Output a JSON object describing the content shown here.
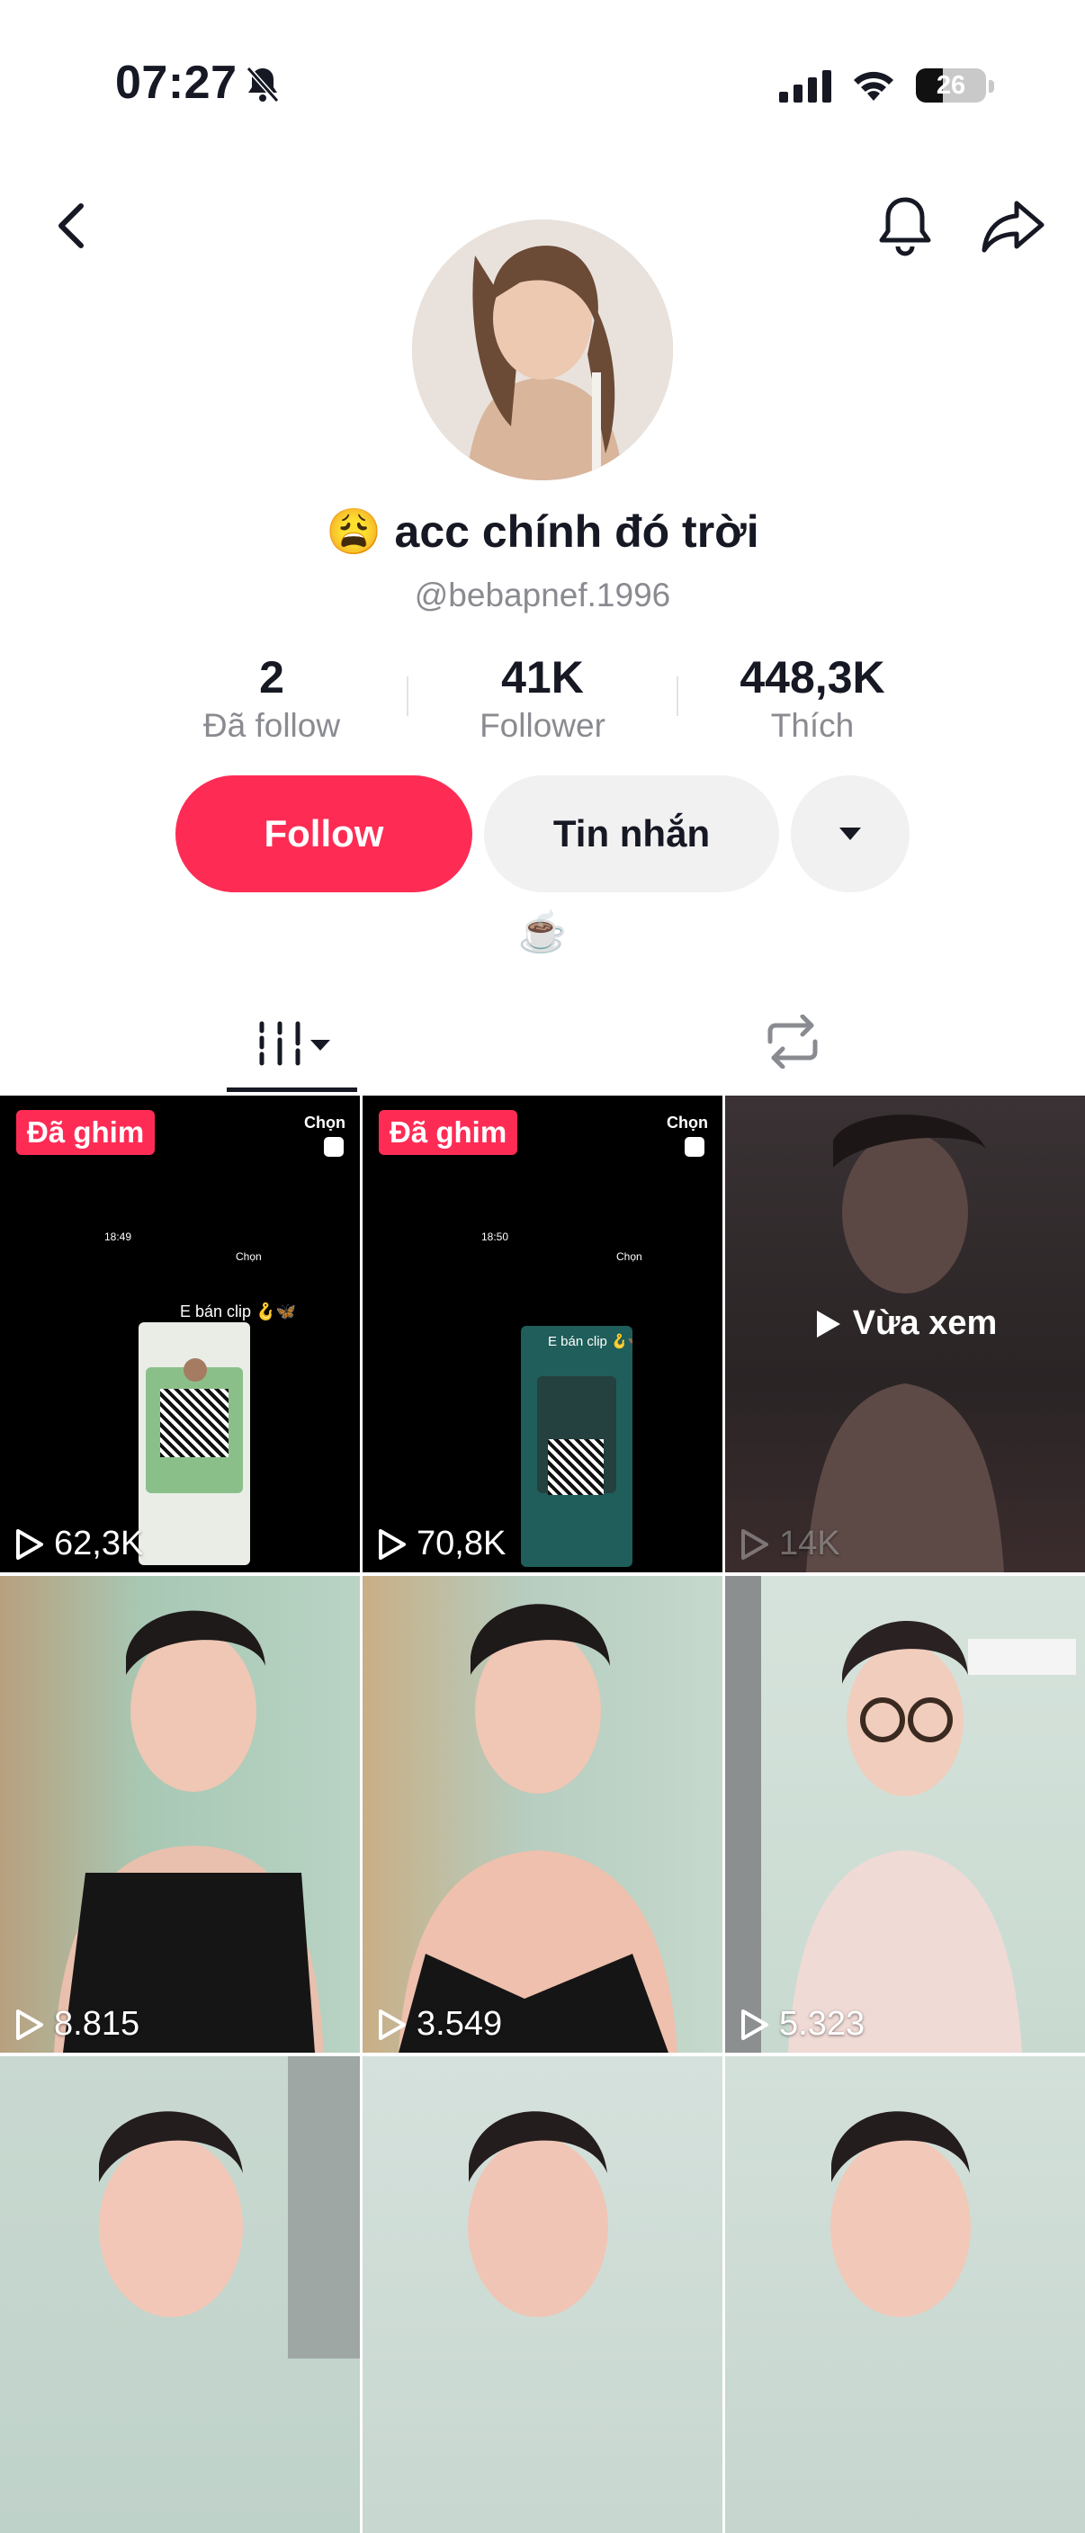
{
  "status_bar": {
    "time": "07:27",
    "battery": "26"
  },
  "profile": {
    "emoji": "😩",
    "name": "acc chính đó trời",
    "handle": "@bebapnef.1996",
    "stats": [
      {
        "value": "2",
        "label": "Đã follow"
      },
      {
        "value": "41K",
        "label": "Follower"
      },
      {
        "value": "448,3K",
        "label": "Thích"
      }
    ],
    "buttons": {
      "follow": "Follow",
      "message": "Tin nhắn"
    },
    "bio": "☕"
  },
  "videos": [
    {
      "pinned": "Đã ghim",
      "select": "Chọn",
      "views": "62,3K",
      "inner_time": "18:49",
      "inner_select": "Chọn",
      "inner_caption": "E bán clip 🪝🦋"
    },
    {
      "pinned": "Đã ghim",
      "select": "Chọn",
      "views": "70,8K",
      "inner_time": "18:50",
      "inner_select": "Chọn",
      "inner_caption": "E bán clip 🪝🦋"
    },
    {
      "overlay": "Vừa xem",
      "views": "14K"
    },
    {
      "views": "8.815"
    },
    {
      "views": "3.549"
    },
    {
      "views": "5.323"
    },
    {
      "views": ""
    },
    {
      "views": ""
    },
    {
      "views": ""
    }
  ],
  "colors": {
    "accent": "#fe2c55",
    "secondary_button": "#f1f1f2",
    "muted_text": "#8a8b91"
  }
}
